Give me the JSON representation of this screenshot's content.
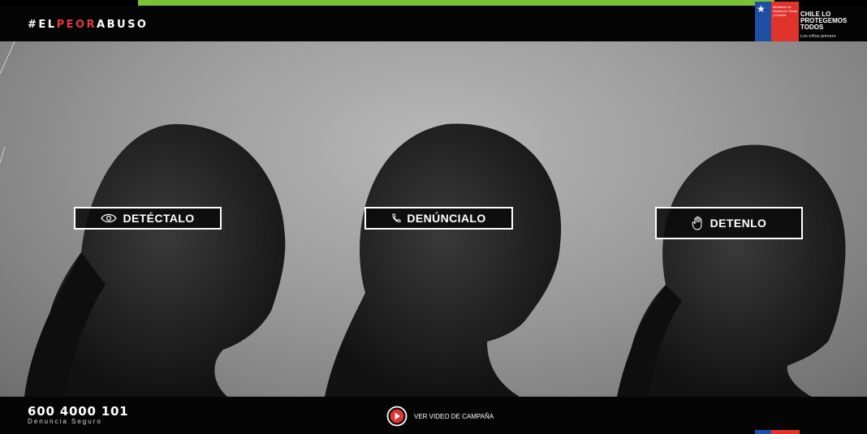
{
  "header": {
    "logo_prefix": "#EL",
    "logo_highlight": "PEOR",
    "logo_suffix": "ABUSO"
  },
  "government": {
    "ministry": "Ministerio de Desarrollo Social y Familia",
    "title": "CHILE LO PROTEGEMOS TODOS",
    "tagline": "Los niños primero"
  },
  "hero": {
    "actions": [
      {
        "label": "DETÉCTALO",
        "icon": "eye-icon"
      },
      {
        "label": "DENÚNCIALO",
        "icon": "phone-icon"
      },
      {
        "label": "DETENLO",
        "icon": "hand-icon"
      }
    ]
  },
  "footer": {
    "phone": "600 4000 101",
    "phone_label": "Denuncia Seguro",
    "video_label": "VER VIDEO DE CAMPAÑA"
  },
  "colors": {
    "accent_green": "#7cc034",
    "logo_red": "#e03a3a",
    "flag_blue": "#1e4fa5",
    "flag_red": "#e0332b",
    "play_red": "#e0332b"
  }
}
